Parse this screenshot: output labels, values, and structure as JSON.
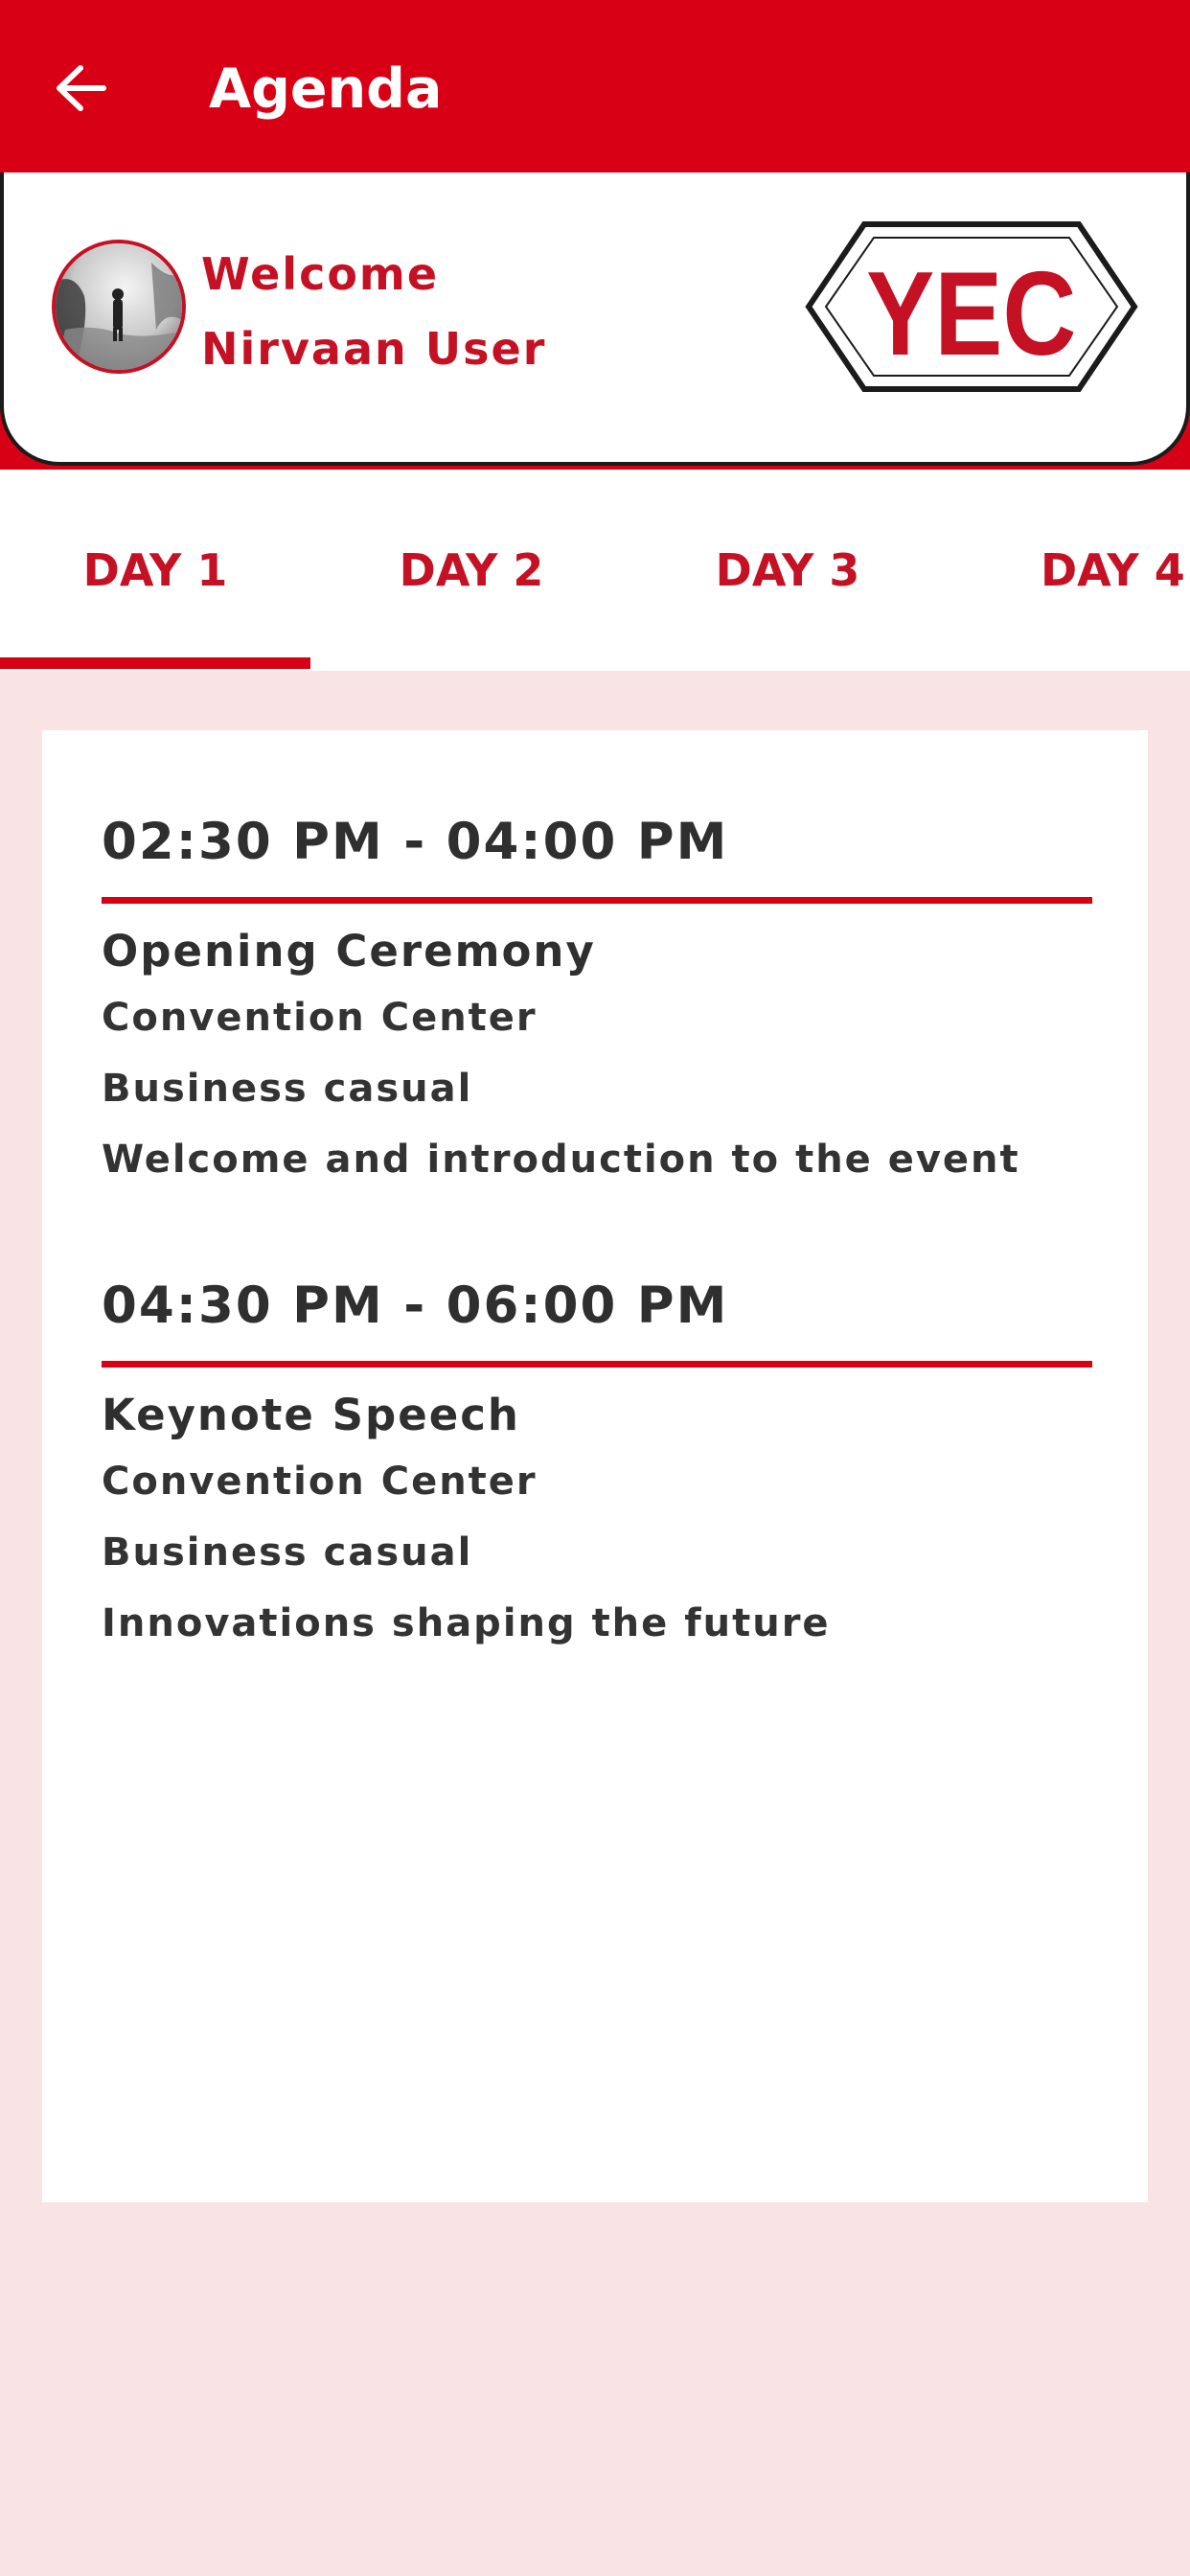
{
  "appbar": {
    "title": "Agenda",
    "back_icon": "arrow-left-icon",
    "background_color": "#d80015"
  },
  "profile": {
    "welcome_line1": "Welcome",
    "welcome_line2": "Nirvaan User",
    "logo_text": "YEC",
    "accent_color": "#c41224"
  },
  "tabs": [
    {
      "label": "DAY 1",
      "selected": true
    },
    {
      "label": "DAY 2",
      "selected": false
    },
    {
      "label": "DAY 3",
      "selected": false
    },
    {
      "label": "DAY 4",
      "selected": false
    }
  ],
  "sessions": [
    {
      "time": "02:30 PM - 04:00 PM",
      "title": "Opening Ceremony",
      "venue": "Convention Center",
      "dress_code": "Business casual",
      "description": "Welcome and introduction to the event"
    },
    {
      "time": "04:30 PM - 06:00 PM",
      "title": "Keynote Speech",
      "venue": "Convention Center",
      "dress_code": "Business casual",
      "description": "Innovations shaping the future"
    }
  ]
}
